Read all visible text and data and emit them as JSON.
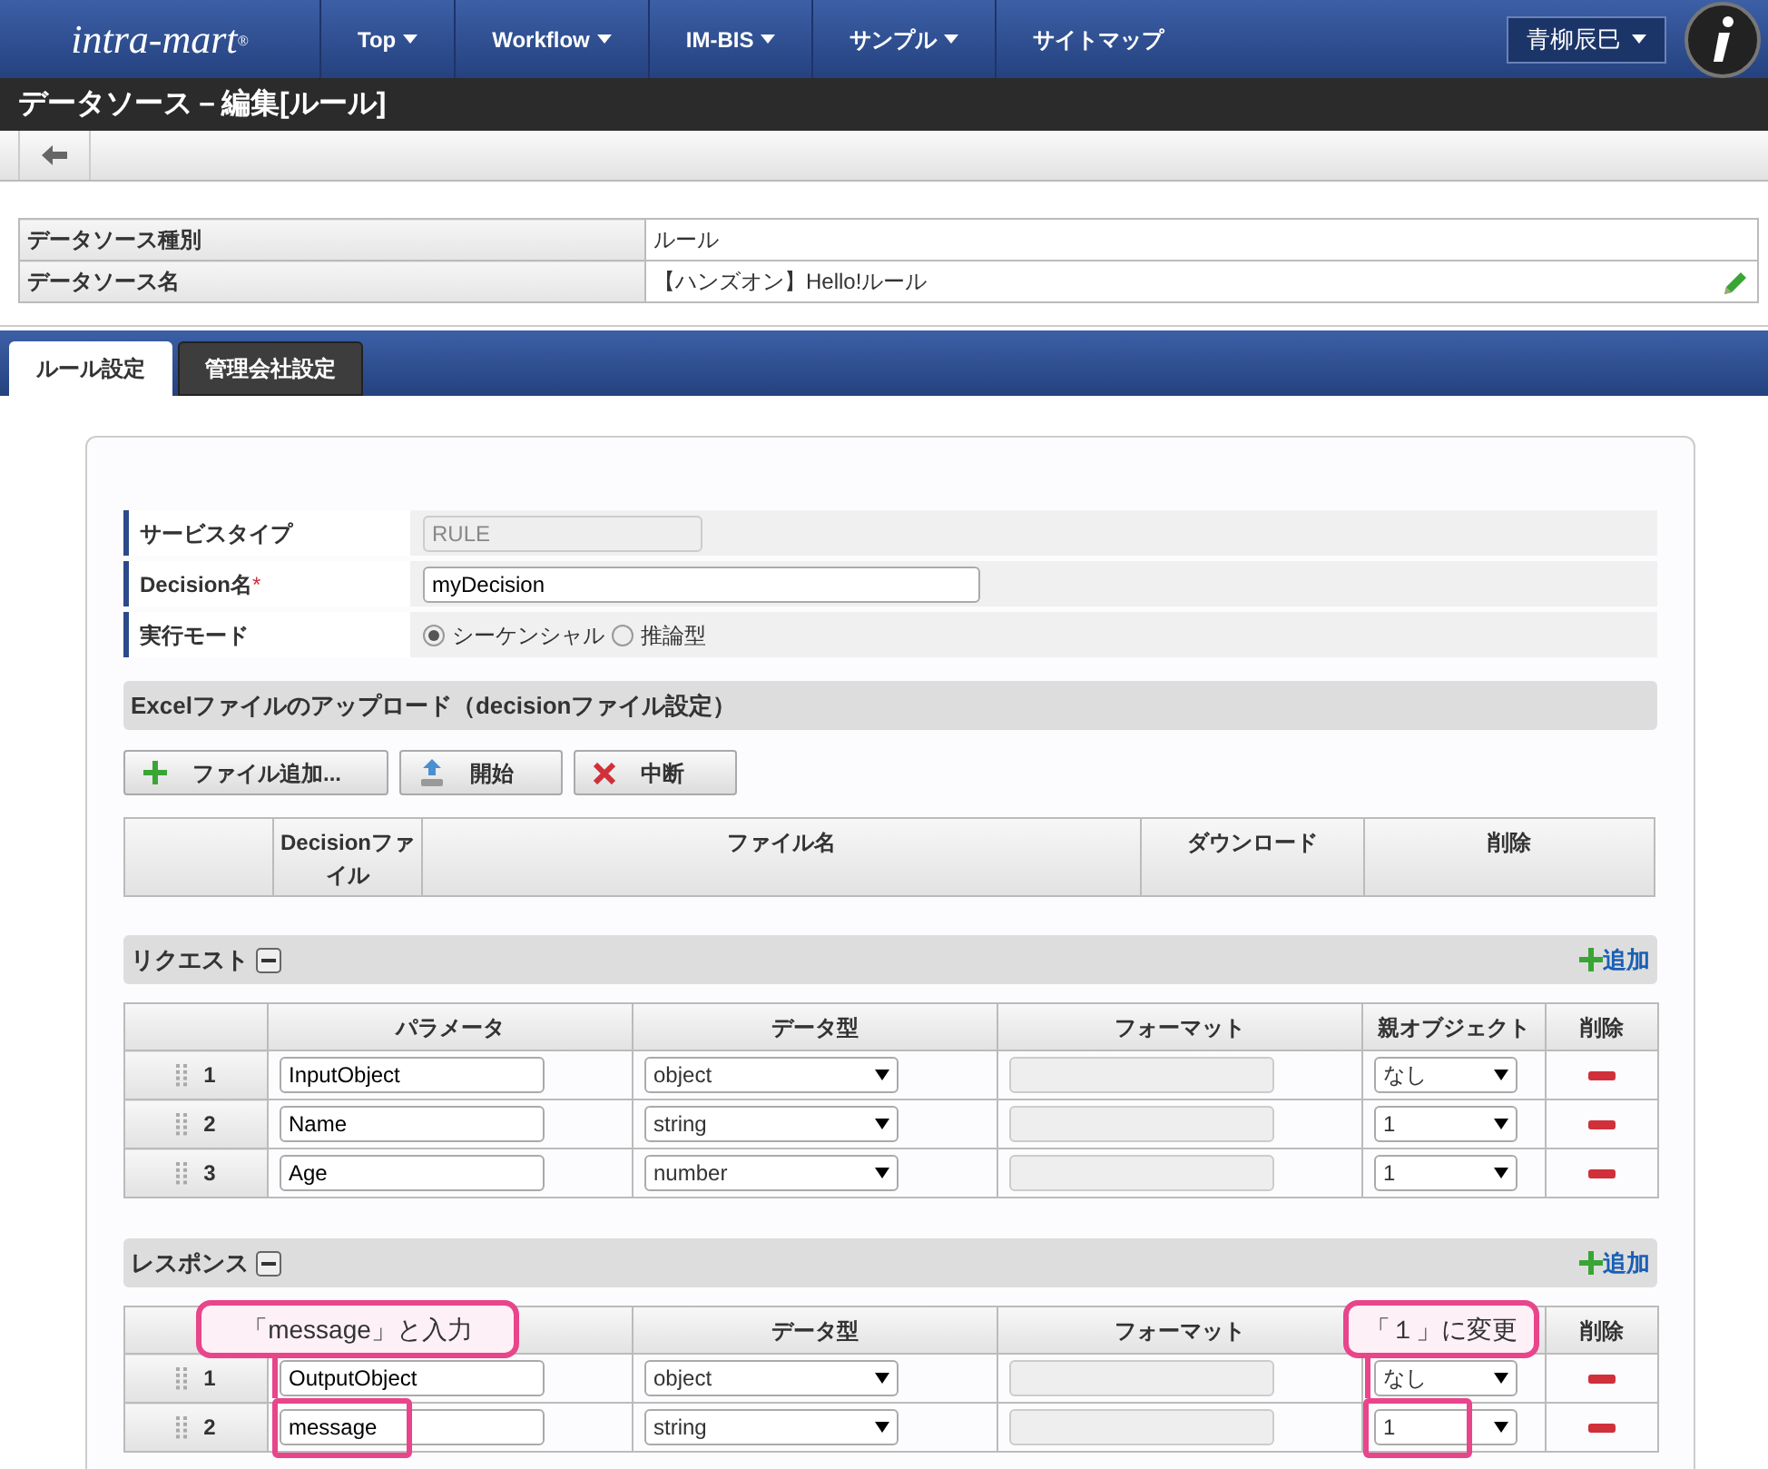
{
  "header": {
    "logo": "intra-mart",
    "logo_mark": "®",
    "menu": [
      {
        "label": "Top",
        "dropdown": true
      },
      {
        "label": "Workflow",
        "dropdown": true
      },
      {
        "label": "IM-BIS",
        "dropdown": true
      },
      {
        "label": "サンプル",
        "dropdown": true
      },
      {
        "label": "サイトマップ",
        "dropdown": false
      }
    ],
    "user": "青柳辰巳"
  },
  "page_title": "データソース－編集[ルール]",
  "info": [
    {
      "label": "データソース種別",
      "value": "ルール",
      "editable": false
    },
    {
      "label": "データソース名",
      "value": "【ハンズオン】Hello!ルール",
      "editable": true
    }
  ],
  "tabs": [
    {
      "label": "ルール設定",
      "selected": true
    },
    {
      "label": "管理会社設定",
      "selected": false
    }
  ],
  "form": [
    {
      "kind": "readonly",
      "label": "サービスタイプ",
      "value": "RULE"
    },
    {
      "kind": "text",
      "label": "Decision名",
      "required": true,
      "required_mark": "*",
      "value": "myDecision"
    },
    {
      "kind": "radio",
      "label": "実行モード",
      "options": [
        {
          "label": "シーケンシャル",
          "selected": true
        },
        {
          "label": "推論型",
          "selected": false
        }
      ]
    }
  ],
  "upload": {
    "title": "Excelファイルのアップロード（decisionファイル設定）",
    "buttons": [
      {
        "kind": "add",
        "label": "ファイル追加..."
      },
      {
        "kind": "upload",
        "label": "開始"
      },
      {
        "kind": "cancel",
        "label": "中断"
      }
    ],
    "columns": [
      "",
      "Decisionファイル",
      "ファイル名",
      "ダウンロード",
      "削除"
    ]
  },
  "request": {
    "title": "リクエスト",
    "add": "追加",
    "columns": [
      "",
      "パラメータ",
      "データ型",
      "フォーマット",
      "親オブジェクト",
      "削除"
    ],
    "rows": [
      {
        "no": "1",
        "param": "InputObject",
        "type": "object",
        "parent": "なし"
      },
      {
        "no": "2",
        "param": "Name",
        "type": "string",
        "parent": "1"
      },
      {
        "no": "3",
        "param": "Age",
        "type": "number",
        "parent": "1"
      }
    ]
  },
  "response": {
    "title": "レスポンス",
    "add": "追加",
    "columns": [
      "",
      "",
      "データ型",
      "フォーマット",
      "",
      "削除"
    ],
    "rows": [
      {
        "no": "1",
        "param": "OutputObject",
        "type": "object",
        "parent": "なし",
        "highlight": false
      },
      {
        "no": "2",
        "param": "message",
        "type": "string",
        "parent": "1",
        "highlight": true
      }
    ]
  },
  "callouts": [
    {
      "text": "「message」と入力"
    },
    {
      "text": "「１」に変更"
    }
  ]
}
